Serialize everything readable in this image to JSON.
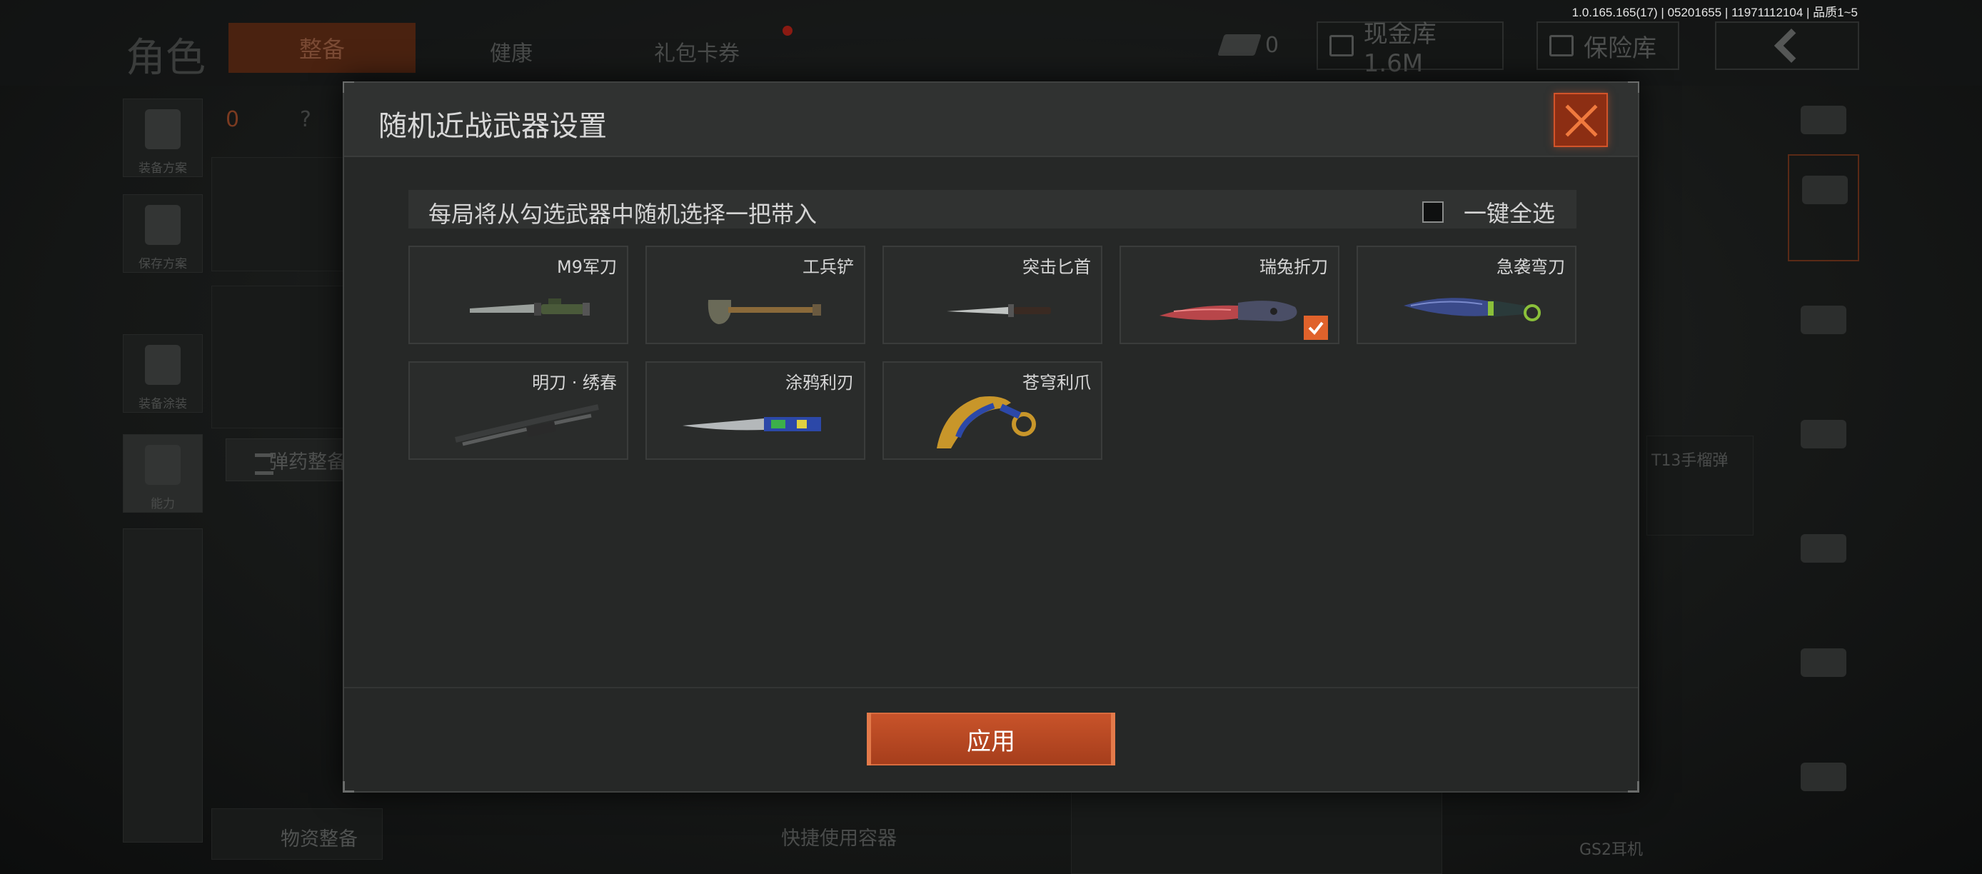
{
  "version_text": "1.0.165.165(17) | 05201655 | 11971112104 | 品质1~5",
  "background": {
    "title": "角色",
    "tabs": [
      "整备",
      "健康",
      "礼包卡券"
    ],
    "currency_count": "0",
    "cash_vault": "现金库 1.6M",
    "safe_box": "保险库",
    "side_items": [
      "装备方案",
      "保存方案",
      "装备涂装",
      "能力"
    ],
    "loadout_count": "0",
    "help_mark": "?",
    "ammo_label": "弹药整备",
    "supplies_label": "物资整备",
    "quick_container": "快捷使用容器",
    "grenade_label": "T13手榴弹",
    "headset_label": "GS2耳机"
  },
  "modal": {
    "title": "随机近战武器设置",
    "subtitle": "每局将从勾选武器中随机选择一把带入",
    "select_all_label": "一键全选",
    "select_all_checked": false,
    "apply_label": "应用",
    "weapons": [
      {
        "name": "M9军刀",
        "checked": false,
        "icon": "bayonet-knife-icon"
      },
      {
        "name": "工兵铲",
        "checked": false,
        "icon": "shovel-icon"
      },
      {
        "name": "突击匕首",
        "checked": false,
        "icon": "dagger-icon"
      },
      {
        "name": "瑞兔折刀",
        "checked": true,
        "icon": "folding-knife-red-icon"
      },
      {
        "name": "急袭弯刀",
        "checked": false,
        "icon": "curved-knife-blue-icon"
      },
      {
        "name": "明刀 · 绣春",
        "checked": false,
        "icon": "chinese-sabre-icon"
      },
      {
        "name": "涂鸦利刃",
        "checked": false,
        "icon": "graffiti-blade-icon"
      },
      {
        "name": "苍穹利爪",
        "checked": false,
        "icon": "karambit-claw-icon"
      }
    ]
  },
  "colors": {
    "accent": "#e0622b",
    "close_bg": "#8c2e13",
    "modal_bg": "#262827"
  }
}
